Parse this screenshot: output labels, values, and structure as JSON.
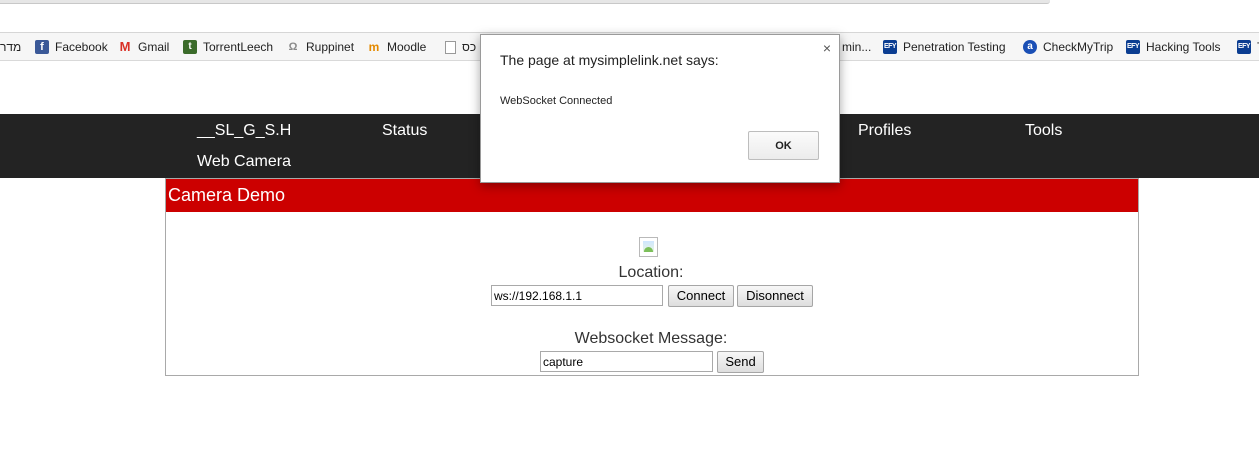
{
  "colors": {
    "nav_bg": "#232323",
    "panel_head_bg": "#cc0000",
    "page_bg": "#ffffff"
  },
  "bookmarks": [
    {
      "label": "מדר",
      "icon": "none"
    },
    {
      "label": "Facebook",
      "icon": "facebook-icon"
    },
    {
      "label": "Gmail",
      "icon": "gmail-icon"
    },
    {
      "label": "TorrentLeech",
      "icon": "torrentleech-icon"
    },
    {
      "label": "Ruppinet",
      "icon": "ruppinet-icon"
    },
    {
      "label": "Moodle",
      "icon": "moodle-icon"
    },
    {
      "label": "כס",
      "icon": "document-icon"
    },
    {
      "label": "min...",
      "icon": "none"
    },
    {
      "label": "Penetration Testing",
      "icon": "efy-icon"
    },
    {
      "label": "CheckMyTrip",
      "icon": "checkmytrip-icon"
    },
    {
      "label": "Hacking Tools",
      "icon": "efy-icon"
    },
    {
      "label": "T",
      "icon": "efy-icon"
    }
  ],
  "nav": {
    "items": [
      "__SL_G_S.H",
      "Status",
      "Profiles",
      "Tools",
      "Web Camera"
    ]
  },
  "panel": {
    "title": "Camera Demo",
    "location_label": "Location:",
    "location_value": "ws://192.168.1.1",
    "connect_label": "Connect",
    "disconnect_label": "Disonnect",
    "message_label": "Websocket Message:",
    "message_value": "capture",
    "send_label": "Send"
  },
  "dialog": {
    "title": "The page at mysimplelink.net says:",
    "message": "WebSocket Connected",
    "ok_label": "OK",
    "close_glyph": "×"
  }
}
